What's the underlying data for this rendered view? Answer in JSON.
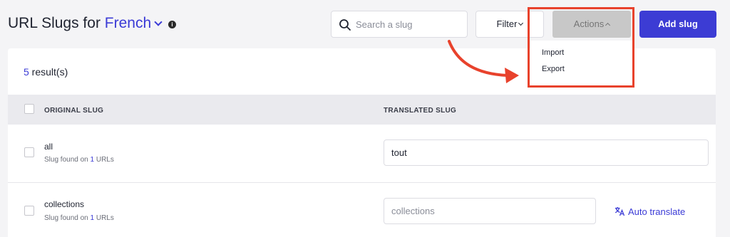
{
  "header": {
    "title_prefix": "URL Slugs for",
    "language": "French",
    "info_icon": "info-icon"
  },
  "search": {
    "placeholder": "Search a slug",
    "icon": "search-icon"
  },
  "toolbar": {
    "filter_label": "Filter",
    "actions_label": "Actions",
    "add_label": "Add slug"
  },
  "actions_menu": {
    "items": [
      {
        "label": "Import"
      },
      {
        "label": "Export"
      }
    ]
  },
  "results": {
    "count": "5",
    "suffix": " result(s)"
  },
  "table": {
    "columns": [
      "ORIGINAL SLUG",
      "TRANSLATED SLUG"
    ],
    "rows": [
      {
        "original": "all",
        "meta_prefix": "Slug found on ",
        "meta_count": "1",
        "meta_suffix": " URLs",
        "translated_value": "tout",
        "translated_placeholder": ""
      },
      {
        "original": "collections",
        "meta_prefix": "Slug found on ",
        "meta_count": "1",
        "meta_suffix": " URLs",
        "translated_value": "",
        "translated_placeholder": "collections",
        "auto_translate_label": "Auto translate"
      }
    ]
  },
  "colors": {
    "accent": "#3b3bd6",
    "primary_button": "#3c3cd4",
    "annotation": "#e8422c"
  }
}
